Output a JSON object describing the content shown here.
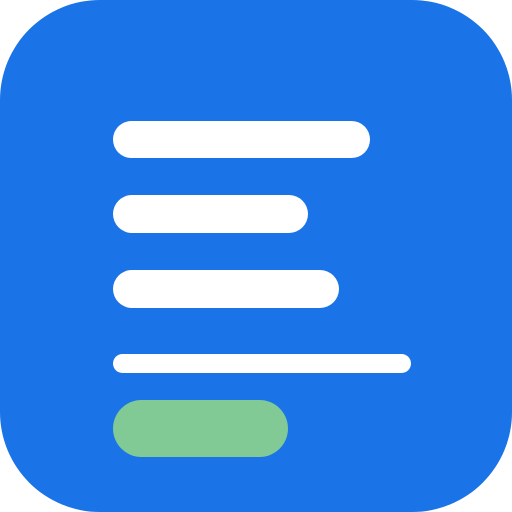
{
  "icon": {
    "name": "document-lines-icon",
    "tile_color": "#1b73e8",
    "line_color": "#ffffff",
    "accent_color": "#81c995"
  }
}
